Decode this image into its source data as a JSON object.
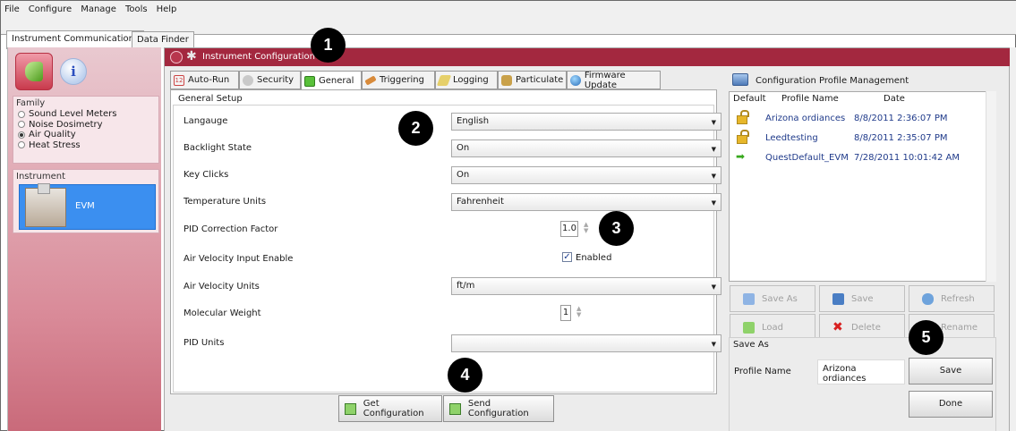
{
  "menu": [
    "File",
    "Configure",
    "Manage",
    "Tools",
    "Help"
  ],
  "top_tabs": [
    {
      "label": "Instrument Communications",
      "active": true
    },
    {
      "label": "Data Finder",
      "active": false
    }
  ],
  "sidebar": {
    "family_title": "Family",
    "family_options": [
      {
        "label": "Sound Level Meters",
        "selected": false
      },
      {
        "label": "Noise Dosimetry",
        "selected": false
      },
      {
        "label": "Air Quality",
        "selected": true
      },
      {
        "label": "Heat Stress",
        "selected": false
      }
    ],
    "instrument_title": "Instrument",
    "instrument_name": "EVM"
  },
  "config": {
    "title": "Instrument Configuration",
    "tabs": [
      {
        "label": "Auto-Run"
      },
      {
        "label": "Security"
      },
      {
        "label": "General",
        "active": true
      },
      {
        "label": "Triggering"
      },
      {
        "label": "Logging"
      },
      {
        "label": "Particulate"
      },
      {
        "label": "Firmware Update"
      }
    ],
    "general_setup_title": "General Setup",
    "fields": {
      "language": {
        "label": "Langauge",
        "value": "English"
      },
      "backlight": {
        "label": "Backlight State",
        "value": "On"
      },
      "key_clicks": {
        "label": "Key Clicks",
        "value": "On"
      },
      "temperature_units": {
        "label": "Temperature Units",
        "value": "Fahrenheit"
      },
      "pid_correction": {
        "label": "PID Correction Factor",
        "value": "1.0"
      },
      "air_velocity_enable": {
        "label": "Air Velocity Input Enable",
        "checkbox_label": "Enabled",
        "checked": true
      },
      "air_velocity_units": {
        "label": "Air Velocity Units",
        "value": "ft/m"
      },
      "molecular_weight": {
        "label": "Molecular Weight",
        "value": "1"
      },
      "pid_units": {
        "label": "PID Units",
        "value": ""
      }
    },
    "get_button": "Get Configuration",
    "send_button": "Send Configuration"
  },
  "profiles": {
    "title": "Configuration Profile Management",
    "columns": [
      "Default",
      "Profile Name",
      "Date"
    ],
    "rows": [
      {
        "name": "Arizona ordiances",
        "date": "8/8/2011 2:36:07 PM",
        "icon": "lock-icon"
      },
      {
        "name": "Leedtesting",
        "date": "8/8/2011 2:35:07 PM",
        "icon": "lock-icon"
      },
      {
        "name": "QuestDefault_EVM",
        "date": "7/28/2011 10:01:42 AM",
        "icon": "arrow-right-icon"
      }
    ],
    "buttons": {
      "save_as": "Save As",
      "save": "Save",
      "refresh": "Refresh",
      "load": "Load",
      "delete": "Delete",
      "rename": "Rename"
    },
    "save_as_title": "Save As",
    "profile_name_label": "Profile Name",
    "profile_name_value": "Arizona ordiances",
    "save_button": "Save",
    "done_button": "Done"
  },
  "callouts": [
    "1",
    "2",
    "3",
    "4",
    "5"
  ]
}
